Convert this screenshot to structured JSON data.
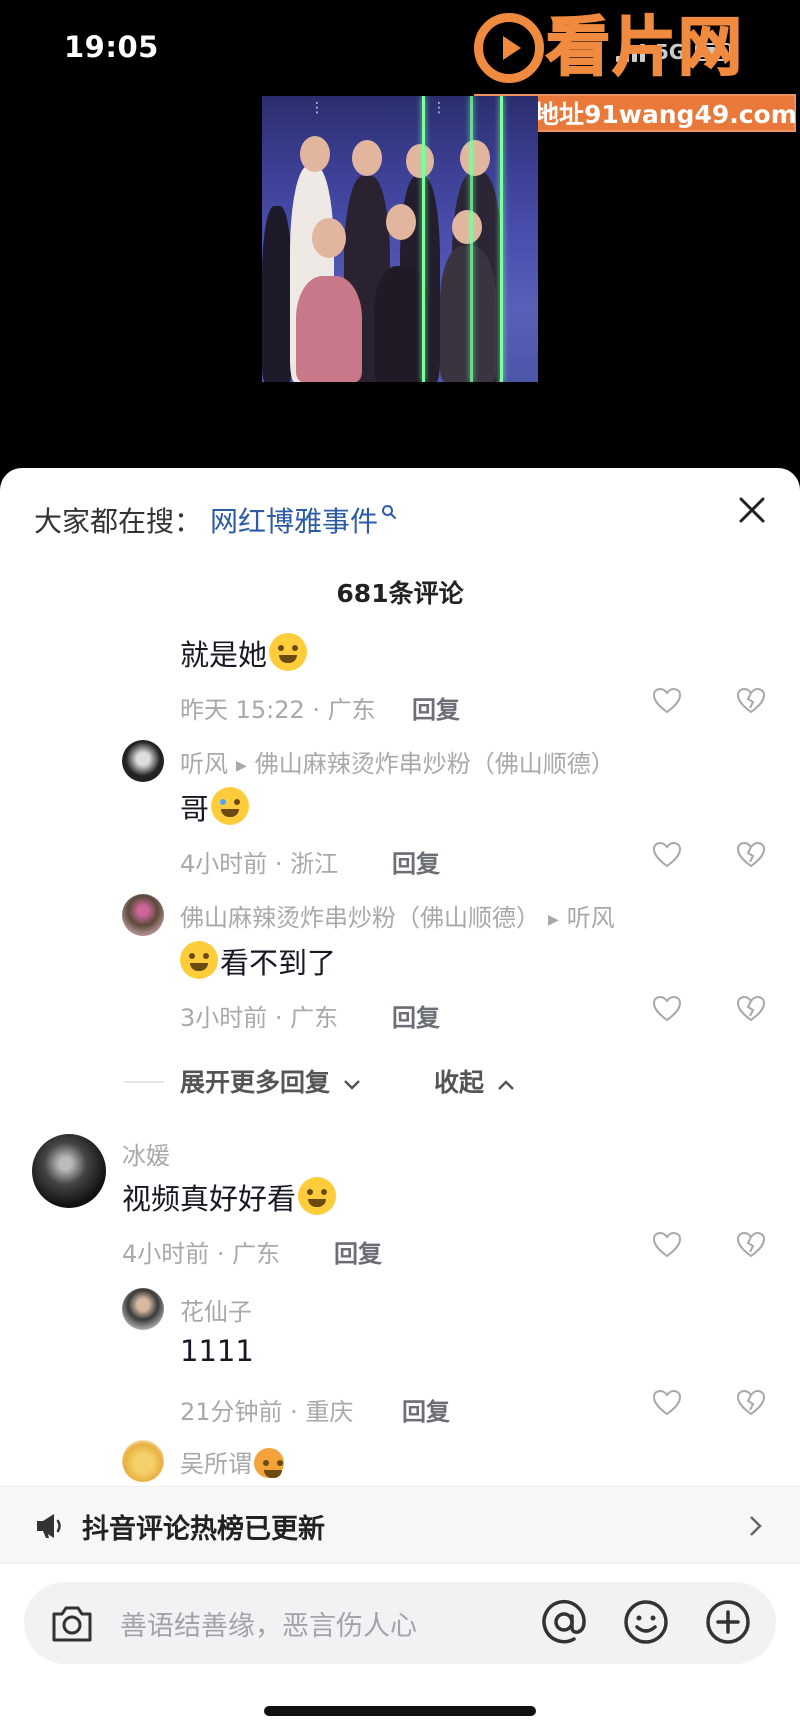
{
  "status_bar": {
    "time": "19:05",
    "network": "5G"
  },
  "watermark": {
    "logo_text": "看片网",
    "url": "最新地址91wang49.com"
  },
  "sheet": {
    "search": {
      "label": "大家都在搜：",
      "term": "网红博雅事件"
    },
    "comment_count": "681条评论",
    "comments": [
      {
        "text": "就是她",
        "emoji": "laugh-cry",
        "meta": "昨天 15:22 · 广东",
        "reply": "回复"
      },
      {
        "user": "听风",
        "reply_to": "佛山麻辣烫炸串炒粉（佛山顺德）",
        "text": "哥",
        "emoji": "crying",
        "meta": "4小时前 · 浙江",
        "reply": "回复"
      },
      {
        "user": "佛山麻辣烫炸串炒粉（佛山顺德）",
        "reply_to": "听风",
        "text": "看不到了",
        "emoji": "grin",
        "meta": "3小时前 · 广东",
        "reply": "回复"
      },
      {
        "user": "冰媛",
        "text": "视频真好好看",
        "emoji": "pleading",
        "meta": "4小时前 · 广东",
        "reply": "回复"
      },
      {
        "user": "花仙子",
        "text": "1111",
        "meta": "21分钟前 · 重庆",
        "reply": "回复"
      },
      {
        "user": "吴所谓",
        "emoji": "puffer-fish"
      }
    ],
    "expand_more": "展开更多回复",
    "collapse": "收起",
    "hotlist": "抖音评论热榜已更新",
    "input_placeholder": "善语结善缘，恶言伤人心"
  },
  "colors": {
    "accent_blue": "#2d5ba8",
    "watermark_orange": "#f08a3e",
    "meta_gray": "#a7a9ad"
  },
  "icons": [
    "search-icon",
    "close-icon",
    "heart-icon",
    "dislike-icon",
    "chevron-down-icon",
    "chevron-up-icon",
    "megaphone-icon",
    "chevron-right-icon",
    "camera-icon",
    "at-icon",
    "smile-icon",
    "plus-icon"
  ]
}
